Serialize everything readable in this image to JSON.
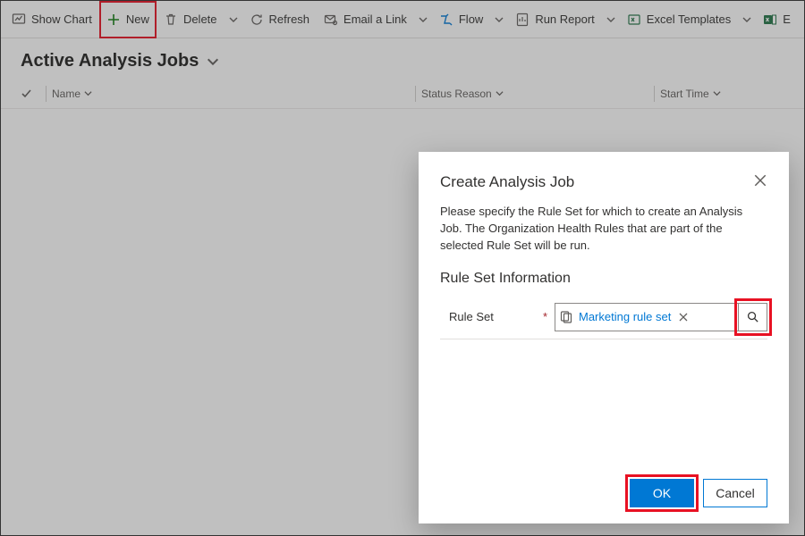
{
  "toolbar": {
    "show_chart": "Show Chart",
    "new": "New",
    "delete": "Delete",
    "refresh": "Refresh",
    "email_link": "Email a Link",
    "flow": "Flow",
    "run_report": "Run Report",
    "excel_templates": "Excel Templates",
    "excel_tail": "E"
  },
  "view": {
    "title": "Active Analysis Jobs"
  },
  "columns": {
    "name": "Name",
    "status": "Status Reason",
    "start": "Start Time"
  },
  "dialog": {
    "title": "Create Analysis Job",
    "body": "Please specify the Rule Set for which to create an Analysis Job. The Organization Health Rules that are part of the selected Rule Set will be run.",
    "section": "Rule Set Information",
    "field_label": "Rule Set",
    "required_marker": "*",
    "selected_value": "Marketing rule set",
    "ok": "OK",
    "cancel": "Cancel"
  }
}
